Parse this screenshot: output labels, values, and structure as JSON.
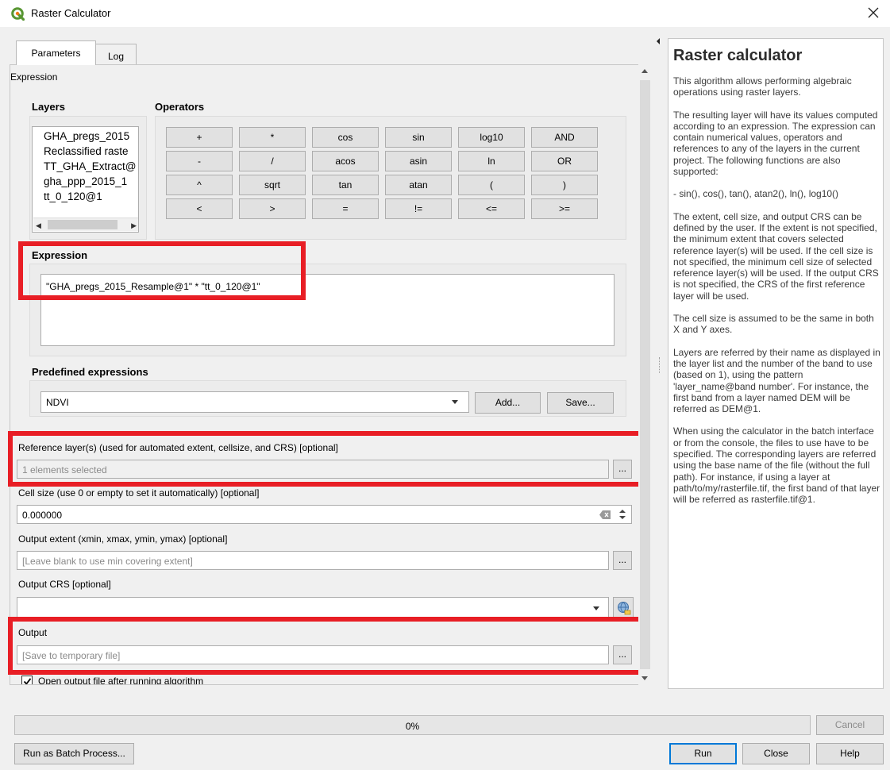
{
  "window": {
    "title": "Raster Calculator",
    "app_icon": "qgis-logo-icon",
    "close_icon": "close-icon"
  },
  "tabs": [
    {
      "label": "Parameters",
      "active": true
    },
    {
      "label": "Log",
      "active": false
    }
  ],
  "params": {
    "section_label": "Expression",
    "layers": {
      "heading": "Layers",
      "items": [
        "GHA_pregs_2015",
        "Reclassified raste",
        "TT_GHA_Extract@",
        "gha_ppp_2015_1",
        "tt_0_120@1"
      ]
    },
    "operators": {
      "heading": "Operators",
      "rows": [
        [
          "+",
          "*",
          "cos",
          "sin",
          "log10",
          "AND"
        ],
        [
          "-",
          "/",
          "acos",
          "asin",
          "ln",
          "OR"
        ],
        [
          "^",
          "sqrt",
          "tan",
          "atan",
          "(",
          ")"
        ],
        [
          "<",
          ">",
          "=",
          "!=",
          "<=",
          ">="
        ]
      ]
    },
    "expression": {
      "heading": "Expression",
      "value": "\"GHA_pregs_2015_Resample@1\" * \"tt_0_120@1\""
    },
    "predefined": {
      "heading": "Predefined expressions",
      "selected": "NDVI",
      "add_label": "Add...",
      "save_label": "Save..."
    },
    "reference_layers": {
      "label": "Reference layer(s) (used for automated extent, cellsize, and CRS) [optional]",
      "value": "1 elements selected",
      "browse": "..."
    },
    "cell_size": {
      "label": "Cell size (use 0 or empty to set it automatically) [optional]",
      "value": "0.000000"
    },
    "output_extent": {
      "label": "Output extent (xmin, xmax, ymin, ymax) [optional]",
      "placeholder": "[Leave blank to use min covering extent]",
      "browse": "..."
    },
    "output_crs": {
      "label": "Output CRS [optional]",
      "value": ""
    },
    "output": {
      "label": "Output",
      "placeholder": "[Save to temporary file]",
      "browse": "..."
    },
    "open_output": {
      "label": "Open output file after running algorithm",
      "checked": true
    }
  },
  "help": {
    "title": "Raster calculator",
    "paragraphs": [
      "This algorithm allows performing algebraic operations using raster layers.",
      "The resulting layer will have its values computed according to an expression. The expression can contain numerical values, operators and references to any of the layers in the current project. The following functions are also supported:",
      "- sin(), cos(), tan(), atan2(), ln(), log10()",
      "The extent, cell size, and output CRS can be defined by the user. If the extent is not specified, the minimum extent that covers selected reference layer(s) will be used. If the cell size is not specified, the minimum cell size of selected reference layer(s) will be used. If the output CRS is not specified, the CRS of the first reference layer will be used.",
      "The cell size is assumed to be the same in both X and Y axes.",
      "Layers are referred by their name as displayed in the layer list and the number of the band to use (based on 1), using the pattern 'layer_name@band number'. For instance, the first band from a layer named DEM will be referred as DEM@1.",
      "When using the calculator in the batch interface or from the console, the files to use have to be specified. The corresponding layers are referred using the base name of the file (without the full path). For instance, if using a layer at path/to/my/rasterfile.tif, the first band of that layer will be referred as rasterfile.tif@1."
    ]
  },
  "footer": {
    "progress": {
      "value": 0,
      "text": "0%"
    },
    "cancel": "Cancel",
    "batch": "Run as Batch Process...",
    "run": "Run",
    "close": "Close",
    "help": "Help"
  },
  "colors": {
    "highlight": "#e81e25",
    "focus": "#0078d7"
  }
}
